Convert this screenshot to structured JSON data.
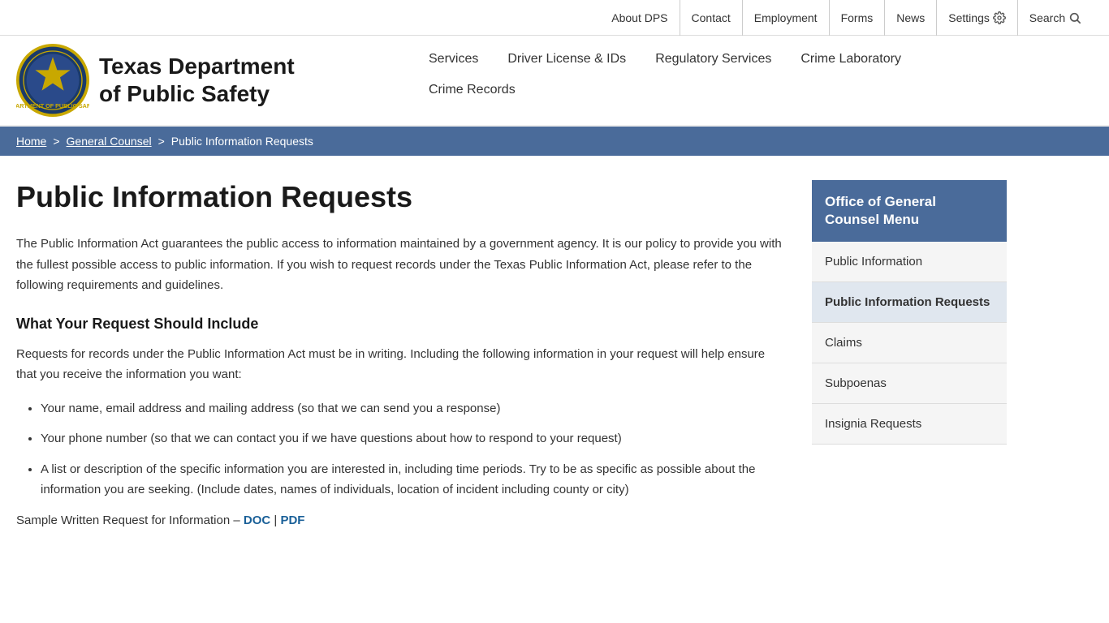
{
  "utility": {
    "links": [
      {
        "label": "About DPS",
        "href": "#"
      },
      {
        "label": "Contact",
        "href": "#"
      },
      {
        "label": "Employment",
        "href": "#"
      },
      {
        "label": "Forms",
        "href": "#"
      },
      {
        "label": "News",
        "href": "#"
      },
      {
        "label": "Settings",
        "href": "#",
        "icon": "gear"
      },
      {
        "label": "Search",
        "href": "#",
        "icon": "search"
      }
    ]
  },
  "header": {
    "logo_text_line1": "Texas Department",
    "logo_text_line2": "of Public Safety"
  },
  "nav": {
    "row1": [
      {
        "label": "Services",
        "href": "#"
      },
      {
        "label": "Driver License & IDs",
        "href": "#"
      },
      {
        "label": "Regulatory Services",
        "href": "#"
      },
      {
        "label": "Crime Laboratory",
        "href": "#"
      }
    ],
    "row2": [
      {
        "label": "Crime Records",
        "href": "#"
      }
    ]
  },
  "breadcrumb": {
    "home": "Home",
    "parent": "General Counsel",
    "current": "Public Information Requests"
  },
  "main": {
    "page_title": "Public Information Requests",
    "intro": "The Public Information Act guarantees the public access to information maintained by a government agency. It is our policy to provide you with the fullest possible access to public information. If you wish to request records under the Texas Public Information Act, please refer to the following requirements and guidelines.",
    "section_heading": "What Your Request Should Include",
    "section_intro": "Requests for records under the Public Information Act must be in writing.  Including the following information in your request will help ensure that you receive the information you want:",
    "bullets": [
      "Your name, email address and mailing address (so that we can send you a response)",
      "Your phone number (so that we can contact you if we have questions about how to respond to your request)",
      "A list or description of the specific information you are interested in, including time periods.  Try to be as specific as possible about the information you are seeking.  (Include dates, names of individuals, location of incident including county or city)"
    ],
    "sample_label": "Sample Written Request for Information – ",
    "sample_doc": "DOC",
    "sample_pdf": "PDF"
  },
  "sidebar": {
    "menu_title": "Office of General Counsel Menu",
    "items": [
      {
        "label": "Public Information",
        "href": "#",
        "active": false
      },
      {
        "label": "Public Information Requests",
        "href": "#",
        "active": true
      },
      {
        "label": "Claims",
        "href": "#",
        "active": false
      },
      {
        "label": "Subpoenas",
        "href": "#",
        "active": false
      },
      {
        "label": "Insignia Requests",
        "href": "#",
        "active": false
      }
    ]
  }
}
